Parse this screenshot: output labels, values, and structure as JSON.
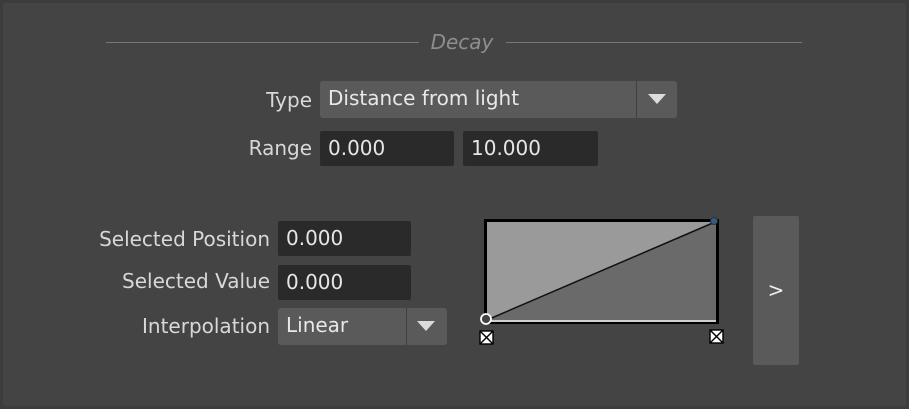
{
  "section": {
    "title": "Decay"
  },
  "decay": {
    "type_label": "Type",
    "type_value": "Distance from light",
    "range_label": "Range",
    "range_min": "0.000",
    "range_max": "10.000"
  },
  "ramp": {
    "selected_position_label": "Selected Position",
    "selected_position_value": "0.000",
    "selected_value_label": "Selected Value",
    "selected_value_value": "0.000",
    "interpolation_label": "Interpolation",
    "interpolation_value": "Linear",
    "expand_label": ">",
    "curve_points": [
      {
        "position": 0.0,
        "value": 0.0
      },
      {
        "position": 1.0,
        "value": 1.0
      }
    ]
  },
  "colors": {
    "panel_bg": "#444444",
    "field_bg": "#2a2a2a",
    "dropdown_bg": "#5a5a5a",
    "graph_upper": "#9a9a9a",
    "graph_lower": "#6a6a6a"
  },
  "icons": {
    "type_dropdown": "chevron-down-icon",
    "interpolation_dropdown": "chevron-down-icon",
    "point_delete": "delete-point-icon",
    "point_handle": "curve-point-icon"
  }
}
